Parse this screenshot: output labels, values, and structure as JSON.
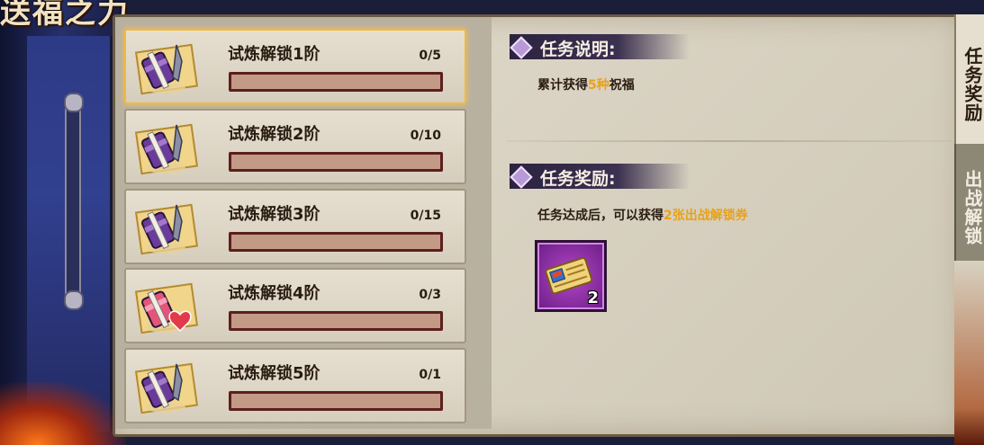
{
  "header": {
    "title_fragment": "送福之力"
  },
  "tasks": [
    {
      "name": "试炼解锁1阶",
      "progress": "0/5",
      "current": 0,
      "total": 5,
      "selected": true,
      "icon": "purple-scroll-kunai-icon"
    },
    {
      "name": "试炼解锁2阶",
      "progress": "0/10",
      "current": 0,
      "total": 10,
      "selected": false,
      "icon": "purple-scroll-kunai-icon"
    },
    {
      "name": "试炼解锁3阶",
      "progress": "0/15",
      "current": 0,
      "total": 15,
      "selected": false,
      "icon": "purple-scroll-kunai-icon"
    },
    {
      "name": "试炼解锁4阶",
      "progress": "0/3",
      "current": 0,
      "total": 3,
      "selected": false,
      "icon": "pink-scroll-heart-icon"
    },
    {
      "name": "试炼解锁5阶",
      "progress": "0/1",
      "current": 0,
      "total": 1,
      "selected": false,
      "icon": "purple-scroll-kunai-icon"
    }
  ],
  "detail": {
    "description_heading": "任务说明:",
    "description_pre": "累计获得",
    "description_highlight": "5种",
    "description_post": "祝福",
    "reward_heading": "任务奖励:",
    "reward_text_pre": "任务达成后，可以获得",
    "reward_text_highlight": "2张出战解锁券",
    "reward_item": {
      "icon": "battle-unlock-ticket-icon",
      "quantity": "2"
    }
  },
  "tabs": [
    {
      "label": "任务奖励",
      "active": true
    },
    {
      "label": "出战解锁",
      "active": false
    }
  ],
  "colors": {
    "highlight": "#e8a21a",
    "selected_border": "#f3b93a",
    "bar_border": "#5b1f1c"
  }
}
